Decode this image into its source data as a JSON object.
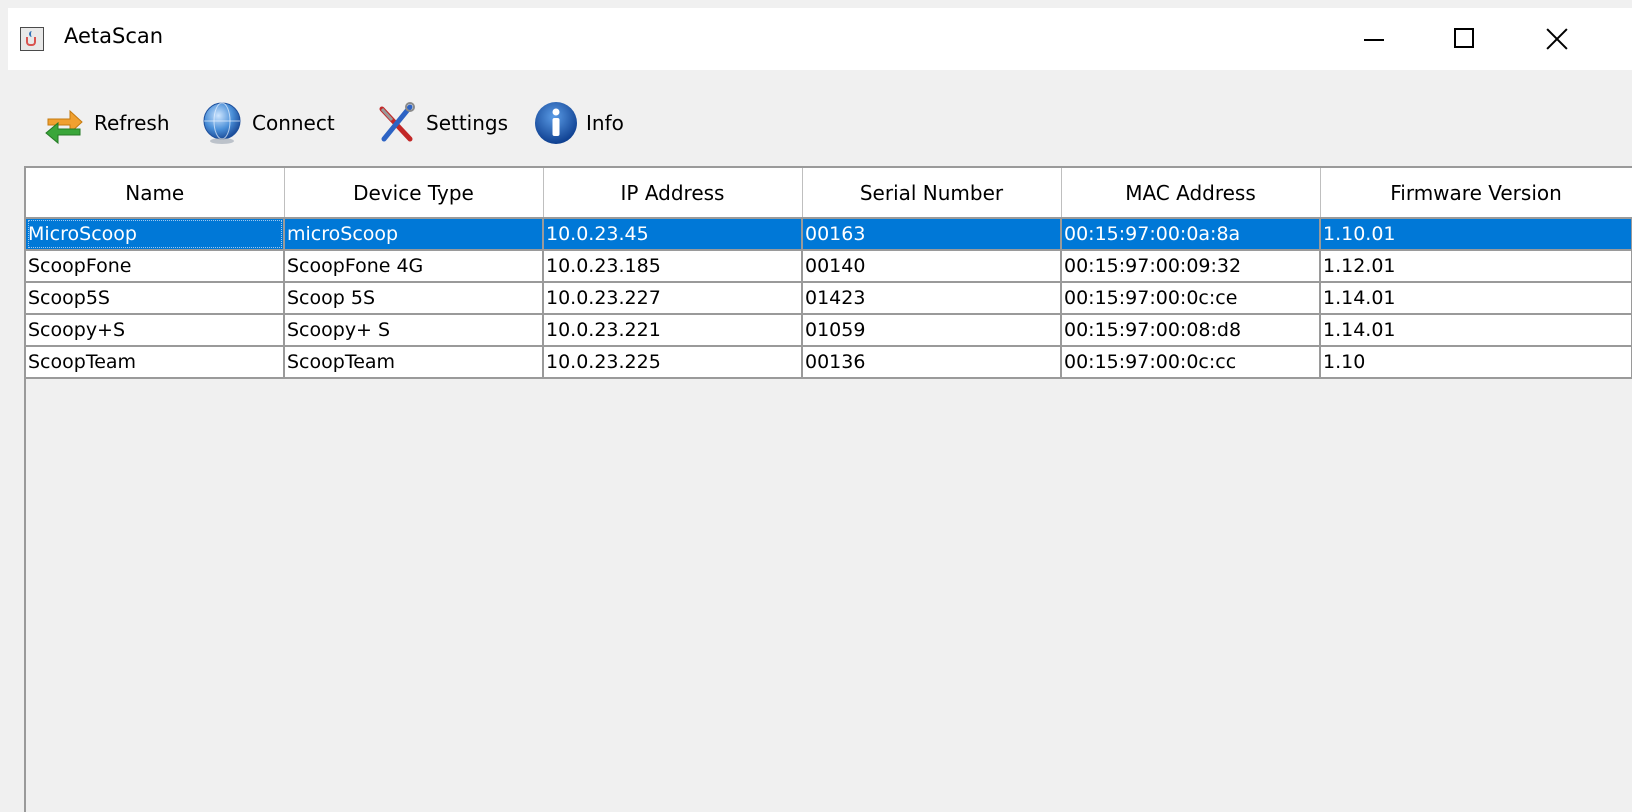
{
  "window": {
    "title": "AetaScan",
    "icon": "java-cup-icon"
  },
  "toolbar": {
    "refresh_label": "Refresh",
    "connect_label": "Connect",
    "settings_label": "Settings",
    "info_label": "Info"
  },
  "table": {
    "headers": [
      "Name",
      "Device Type",
      "IP Address",
      "Serial Number",
      "MAC Address",
      "Firmware Version"
    ],
    "rows": [
      [
        "MicroScoop",
        "microScoop",
        "10.0.23.45",
        "00163",
        "00:15:97:00:0a:8a",
        "1.10.01"
      ],
      [
        "ScoopFone",
        "ScoopFone 4G",
        "10.0.23.185",
        "00140",
        "00:15:97:00:09:32",
        "1.12.01"
      ],
      [
        "Scoop5S",
        "Scoop 5S",
        "10.0.23.227",
        "01423",
        "00:15:97:00:0c:ce",
        "1.14.01"
      ],
      [
        "Scoopy+S",
        "Scoopy+ S",
        "10.0.23.221",
        "01059",
        "00:15:97:00:08:d8",
        "1.14.01"
      ],
      [
        "ScoopTeam",
        "ScoopTeam",
        "10.0.23.225",
        "00136",
        "00:15:97:00:0c:cc",
        "1.10"
      ]
    ],
    "selected_row": 0
  },
  "colors": {
    "selection": "#0078d7",
    "background": "#f0f0f0"
  }
}
